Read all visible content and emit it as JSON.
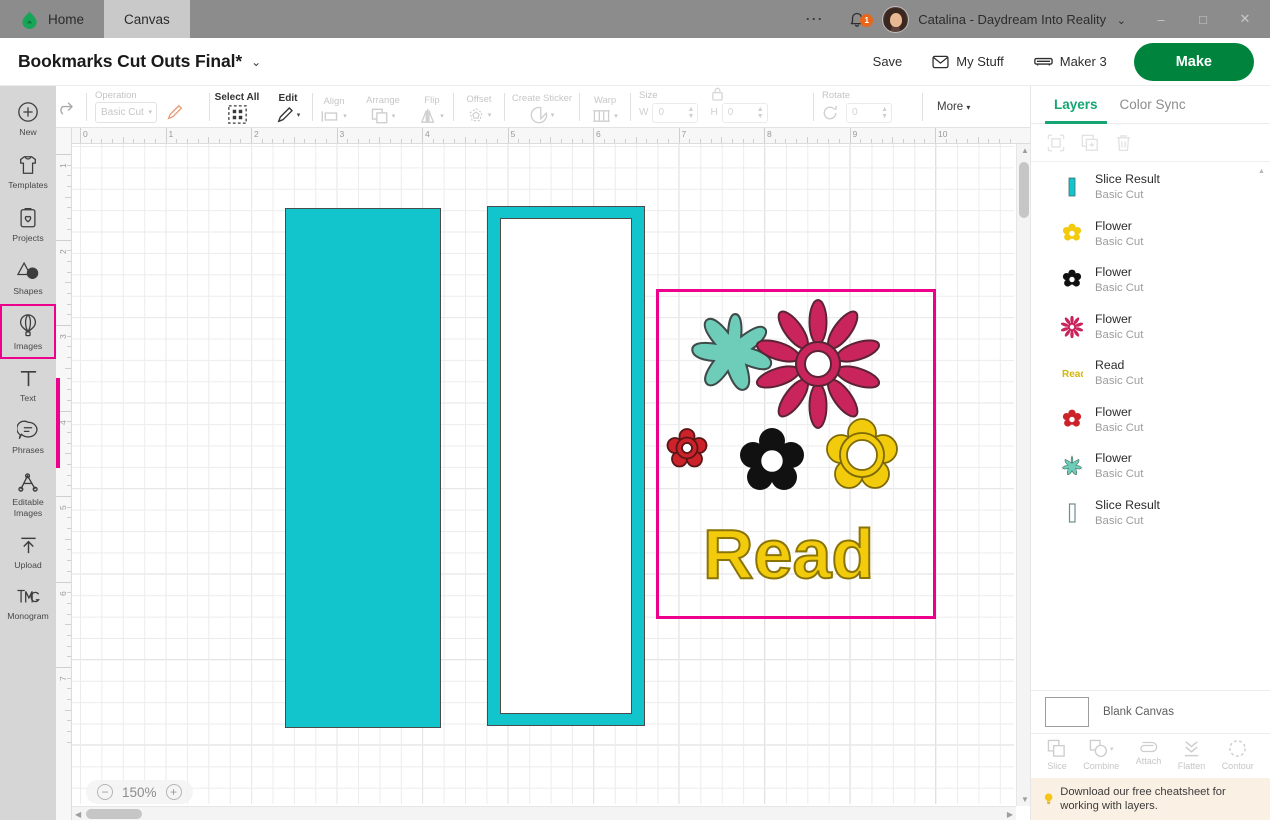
{
  "titlebar": {
    "tabs": [
      {
        "label": "Home",
        "icon": "cricut-home-logo",
        "active": false
      },
      {
        "label": "Canvas",
        "icon": "",
        "active": true
      }
    ],
    "overflow_icon": "more-dots-icon",
    "notification_icon": "bell-icon",
    "notification_count": "1",
    "user_name": "Catalina - Daydream Into Reality",
    "user_caret": "⌄",
    "window_minimize": "–",
    "window_maximize": "□",
    "window_close": "✕"
  },
  "header": {
    "project_title": "Bookmarks Cut Outs Final*",
    "title_caret": "⌄",
    "save_label": "Save",
    "my_stuff_label": "My Stuff",
    "machine_label": "Maker 3",
    "make_label": "Make",
    "accent_green": "#00843d"
  },
  "toolbar": {
    "undo_icon": "undo-arrow-icon",
    "redo_icon": "redo-arrow-icon",
    "operation_label": "Operation",
    "operation_value": "Basic Cut",
    "select_all_label": "Select All",
    "edit_label": "Edit",
    "align_label": "Align",
    "arrange_label": "Arrange",
    "flip_label": "Flip",
    "offset_label": "Offset",
    "create_sticker_label": "Create Sticker",
    "warp_label": "Warp",
    "size_label": "Size",
    "size_w_label": "W",
    "size_w_value": "0",
    "size_h_label": "H",
    "size_h_value": "0",
    "lock_icon": "lock-icon",
    "rotate_label": "Rotate",
    "rotate_value": "0",
    "more_label": "More"
  },
  "sidebar": {
    "items": [
      {
        "label": "New",
        "icon": "plus-circle-icon",
        "selected": false
      },
      {
        "label": "Templates",
        "icon": "tshirt-icon",
        "selected": false
      },
      {
        "label": "Projects",
        "icon": "clipboard-heart-icon",
        "selected": false
      },
      {
        "label": "Shapes",
        "icon": "shapes-icon",
        "selected": false
      },
      {
        "label": "Images",
        "icon": "hot-air-balloon-icon",
        "selected": true
      },
      {
        "label": "Text",
        "icon": "text-t-icon",
        "selected": false
      },
      {
        "label": "Phrases",
        "icon": "speech-bubble-icon",
        "selected": false
      },
      {
        "label": "Editable Images",
        "icon": "editable-images-icon",
        "selected": false
      },
      {
        "label": "Upload",
        "icon": "upload-arrow-icon",
        "selected": false
      },
      {
        "label": "Monogram",
        "icon": "monogram-icon",
        "selected": false
      }
    ],
    "selection_color": "#ec008c"
  },
  "canvas": {
    "ruler_h_numbers": [
      "0",
      "1",
      "2",
      "3",
      "4",
      "5",
      "6",
      "7",
      "8",
      "9",
      "10"
    ],
    "ruler_v_numbers": [
      "1",
      "2",
      "3",
      "4",
      "5",
      "6",
      "7"
    ],
    "zoom_level": "150%",
    "zoom_out_icon": "minus-circle-icon",
    "zoom_in_icon": "plus-circle-icon",
    "shapes": [
      {
        "name": "bookmark-solid",
        "type": "solid-rect",
        "color": "#12c4cc"
      },
      {
        "name": "bookmark-frame",
        "type": "frame-rect",
        "color": "#12c4cc"
      },
      {
        "name": "flower-star-teal",
        "color": "#6dcdb8"
      },
      {
        "name": "flower-daisy-magenta",
        "color": "#c9255c"
      },
      {
        "name": "flower-small-red",
        "color": "#cc2229"
      },
      {
        "name": "flower-black",
        "color": "#111111"
      },
      {
        "name": "flower-yellow",
        "color": "#f2cb0d"
      },
      {
        "name": "read-word",
        "text": "Read",
        "color": "#f2cb0d"
      }
    ],
    "selection_color": "#ec008c"
  },
  "right_panel": {
    "tabs": [
      {
        "label": "Layers",
        "active": true
      },
      {
        "label": "Color Sync",
        "active": false
      }
    ],
    "actions": [
      {
        "name": "group-icon"
      },
      {
        "name": "duplicate-icon"
      },
      {
        "name": "delete-icon"
      }
    ],
    "layers": [
      {
        "name": "Slice Result",
        "sub": "Basic Cut",
        "thumb": "bar-teal",
        "color": "#12c4cc"
      },
      {
        "name": "Flower",
        "sub": "Basic Cut",
        "thumb": "flower-yellow",
        "color": "#f2cb0d"
      },
      {
        "name": "Flower",
        "sub": "Basic Cut",
        "thumb": "flower-black",
        "color": "#111111"
      },
      {
        "name": "Flower",
        "sub": "Basic Cut",
        "thumb": "flower-magenta",
        "color": "#c9255c"
      },
      {
        "name": "Read",
        "sub": "Basic Cut",
        "thumb": "read-yellow",
        "color": "#d4b50a"
      },
      {
        "name": "Flower",
        "sub": "Basic Cut",
        "thumb": "flower-red",
        "color": "#cc2229"
      },
      {
        "name": "Flower",
        "sub": "Basic Cut",
        "thumb": "flower-star-teal",
        "color": "#6dcdb8"
      },
      {
        "name": "Slice Result",
        "sub": "Basic Cut",
        "thumb": "bar-outline",
        "color": "#6b8f8f"
      }
    ],
    "blank_canvas_label": "Blank Canvas",
    "tools": [
      {
        "label": "Slice",
        "icon": "slice-icon",
        "caret": false
      },
      {
        "label": "Combine",
        "icon": "combine-icon",
        "caret": true
      },
      {
        "label": "Attach",
        "icon": "attach-paperclip-icon",
        "caret": false
      },
      {
        "label": "Flatten",
        "icon": "flatten-icon",
        "caret": false
      },
      {
        "label": "Contour",
        "icon": "contour-icon",
        "caret": false
      }
    ],
    "cheatsheet_icon": "lightbulb-icon",
    "cheatsheet_text": "Download our free cheatsheet for working with layers."
  }
}
